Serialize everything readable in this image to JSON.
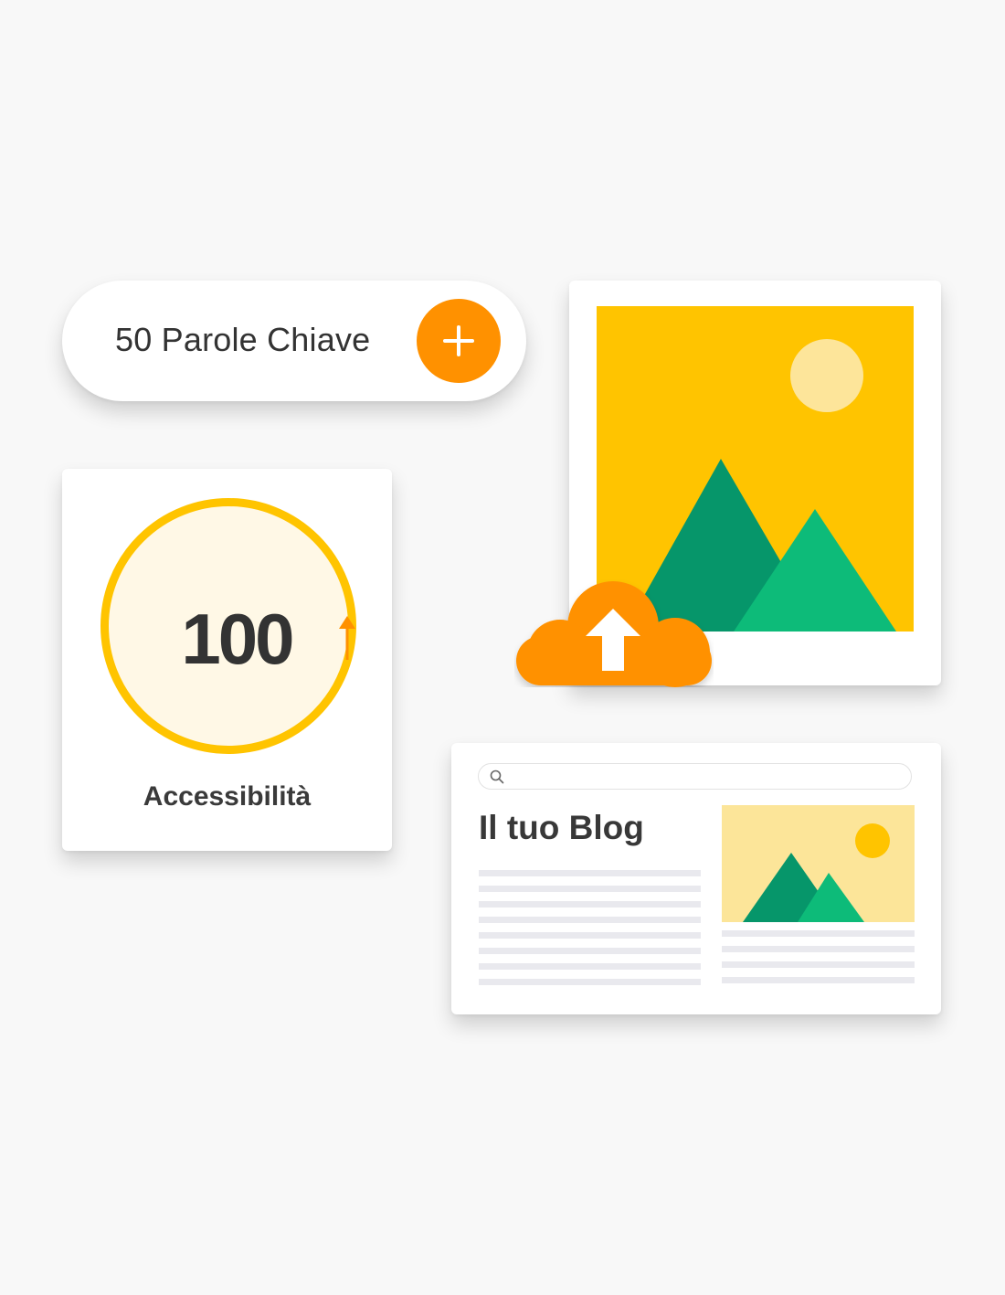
{
  "keywords": {
    "label": "50 Parole Chiave",
    "add_icon": "plus-icon"
  },
  "score": {
    "value": "100",
    "trend_icon": "arrow-up-icon",
    "label": "Accessibilità"
  },
  "image_card": {
    "icon": "image-placeholder-icon",
    "upload_icon": "cloud-upload-icon"
  },
  "blog": {
    "search_icon": "search-icon",
    "title": "Il tuo Blog",
    "thumbnail_icon": "image-placeholder-icon"
  },
  "colors": {
    "accent_orange": "#ff9100",
    "accent_yellow": "#ffc400",
    "green_dark": "#06966a",
    "green_light": "#0dbb79",
    "sun": "#fde59a",
    "thumb_bg": "#fce599",
    "line": "#e9e9ee"
  }
}
